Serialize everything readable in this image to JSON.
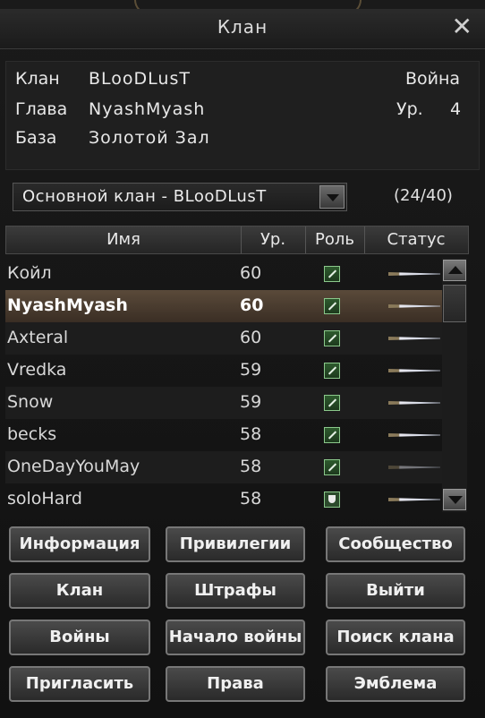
{
  "window": {
    "title": "Клан",
    "close": "✕"
  },
  "info": {
    "clan_label": "Клан",
    "clan_value": "BLooDLusT",
    "leader_label": "Глава",
    "leader_value": "NyashMyash",
    "base_label": "База",
    "base_value": "Золотой Зал",
    "war_label": "Война",
    "level_label": "Ур.",
    "level_value": "4"
  },
  "selector": {
    "value": "Основной клан - BLooDLusT",
    "count": "(24/40)"
  },
  "table": {
    "headers": {
      "name": "Имя",
      "level": "Ур.",
      "role": "Роль",
      "status": "Статус"
    },
    "rows": [
      {
        "name": "Койл",
        "level": "60",
        "role": "sword-icon",
        "status": "dagger-icon"
      },
      {
        "name": "NyashMyash",
        "level": "60",
        "role": "sword-icon",
        "status": "dagger-icon"
      },
      {
        "name": "Axteral",
        "level": "60",
        "role": "sword-icon",
        "status": "dagger-icon"
      },
      {
        "name": "Vredka",
        "level": "59",
        "role": "sword-icon",
        "status": "dagger-icon"
      },
      {
        "name": "Snow",
        "level": "59",
        "role": "sword-icon",
        "status": "dagger-icon"
      },
      {
        "name": "becks",
        "level": "58",
        "role": "sword-icon",
        "status": "dagger-icon"
      },
      {
        "name": "OneDayYouMay",
        "level": "58",
        "role": "sword-icon",
        "status": "dagger-icon"
      },
      {
        "name": "soloHard",
        "level": "58",
        "role": "shield-icon",
        "status": "dagger-icon"
      }
    ]
  },
  "buttons": {
    "info": "Информация",
    "privileges": "Привилегии",
    "community": "Сообщество",
    "clan": "Клан",
    "penalties": "Штрафы",
    "leave": "Выйти",
    "wars": "Войны",
    "start_war": "Начало войны",
    "search_clan": "Поиск клана",
    "invite": "Пригласить",
    "rights": "Права",
    "emblem": "Эмблема"
  }
}
